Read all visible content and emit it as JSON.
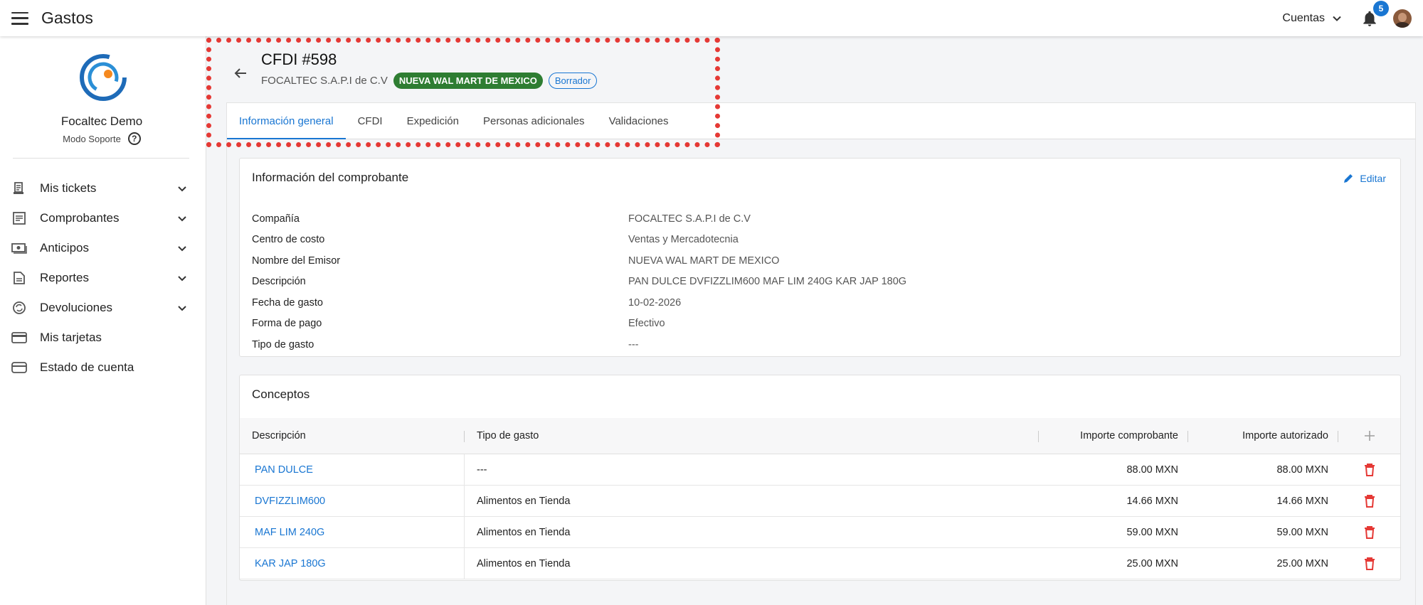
{
  "app": {
    "title": "Gastos"
  },
  "topbar": {
    "accounts_label": "Cuentas",
    "notification_count": "5"
  },
  "sidebar": {
    "company_name": "Focaltec Demo",
    "support_mode": "Modo Soporte",
    "help_glyph": "?",
    "items": [
      {
        "label": "Mis tickets",
        "icon": "receipt-icon",
        "expandable": true
      },
      {
        "label": "Comprobantes",
        "icon": "document-icon",
        "expandable": true
      },
      {
        "label": "Anticipos",
        "icon": "money-icon",
        "expandable": true
      },
      {
        "label": "Reportes",
        "icon": "report-icon",
        "expandable": true
      },
      {
        "label": "Devoluciones",
        "icon": "refund-icon",
        "expandable": true
      },
      {
        "label": "Mis tarjetas",
        "icon": "card-icon",
        "expandable": false
      },
      {
        "label": "Estado de cuenta",
        "icon": "wallet-icon",
        "expandable": false
      }
    ]
  },
  "header": {
    "title": "CFDI #598",
    "company": "FOCALTEC S.A.P.I de C.V",
    "issuer_chip": "NUEVA WAL MART DE MEXICO",
    "status_chip": "Borrador"
  },
  "tabs": [
    {
      "label": "Información general",
      "active": true
    },
    {
      "label": "CFDI",
      "active": false
    },
    {
      "label": "Expedición",
      "active": false
    },
    {
      "label": "Personas adicionales",
      "active": false
    },
    {
      "label": "Validaciones",
      "active": false
    }
  ],
  "info_card": {
    "title": "Información del comprobante",
    "edit_label": "Editar",
    "rows": [
      {
        "label": "Compañía",
        "value": "FOCALTEC S.A.P.I de C.V"
      },
      {
        "label": "Centro de costo",
        "value": "Ventas y Mercadotecnia"
      },
      {
        "label": "Nombre del Emisor",
        "value": "NUEVA WAL MART DE MEXICO"
      },
      {
        "label": "Descripción",
        "value": "PAN DULCE DVFIZZLIM600 MAF LIM 240G KAR JAP 180G"
      },
      {
        "label": "Fecha de gasto",
        "value": "10-02-2026"
      },
      {
        "label": "Forma de pago",
        "value": "Efectivo"
      },
      {
        "label": "Tipo de gasto",
        "value": "---"
      }
    ]
  },
  "concepts": {
    "title": "Conceptos",
    "headers": {
      "description": "Descripción",
      "expense_type": "Tipo de gasto",
      "amount_receipt": "Importe comprobante",
      "amount_authorized": "Importe autorizado"
    },
    "rows": [
      {
        "description": "PAN DULCE",
        "expense_type": "---",
        "amount_receipt": "88.00 MXN",
        "amount_authorized": "88.00 MXN"
      },
      {
        "description": "DVFIZZLIM600",
        "expense_type": "Alimentos en Tienda",
        "amount_receipt": "14.66 MXN",
        "amount_authorized": "14.66 MXN"
      },
      {
        "description": "MAF LIM 240G",
        "expense_type": "Alimentos en Tienda",
        "amount_receipt": "59.00 MXN",
        "amount_authorized": "59.00 MXN"
      },
      {
        "description": "KAR JAP 180G",
        "expense_type": "Alimentos en Tienda",
        "amount_receipt": "25.00 MXN",
        "amount_authorized": "25.00 MXN"
      }
    ]
  },
  "colors": {
    "accent": "#1976d2",
    "success": "#2e7d32",
    "danger": "#e53935",
    "highlight": "#e53935"
  }
}
